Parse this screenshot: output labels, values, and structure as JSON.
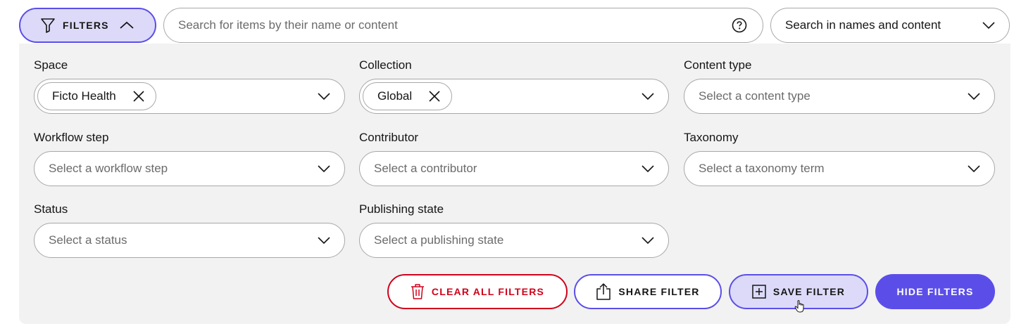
{
  "header": {
    "filters_toggle_label": "FILTERS",
    "search_placeholder": "Search for items by their name or content",
    "search_value": "",
    "scope_selected": "Search in names and content"
  },
  "filters": {
    "space": {
      "label": "Space",
      "chips": [
        "Ficto Health"
      ]
    },
    "collection": {
      "label": "Collection",
      "chips": [
        "Global"
      ]
    },
    "content_type": {
      "label": "Content type",
      "placeholder": "Select a content type"
    },
    "workflow_step": {
      "label": "Workflow step",
      "placeholder": "Select a workflow step"
    },
    "contributor": {
      "label": "Contributor",
      "placeholder": "Select a contributor"
    },
    "taxonomy": {
      "label": "Taxonomy",
      "placeholder": "Select a taxonomy term"
    },
    "status": {
      "label": "Status",
      "placeholder": "Select a status"
    },
    "publishing_state": {
      "label": "Publishing state",
      "placeholder": "Select a publishing state"
    }
  },
  "actions": {
    "clear_all": "CLEAR ALL FILTERS",
    "share": "SHARE FILTER",
    "save": "SAVE FILTER",
    "hide": "HIDE FILTERS"
  },
  "colors": {
    "accent": "#5b4ee8",
    "accent_light": "#dcdaf8",
    "danger": "#d0021b",
    "panel_bg": "#f2f2f2"
  },
  "icons": [
    "filter-icon",
    "chevron-up-icon",
    "help-icon",
    "chevron-down-icon",
    "close-icon",
    "trash-icon",
    "share-icon",
    "add-square-icon",
    "hand-cursor-icon"
  ]
}
